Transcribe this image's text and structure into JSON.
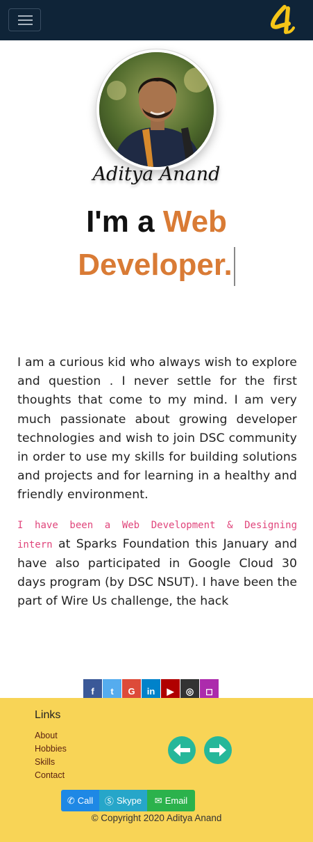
{
  "navbar": {
    "menu_icon": "hamburger-icon",
    "logo_icon": "stylized-4-logo",
    "logo_color": "#f5c518"
  },
  "profile": {
    "name": "Aditya Anand",
    "headline_prefix": "I'm a",
    "headline_accent_1": "Web",
    "headline_accent_2": "Developer.",
    "accent_color": "#d97b35"
  },
  "about": {
    "paragraph_1": "I am a curious kid who always wish to explore and question . I never settle for the first thoughts that come to my mind. I am very much passionate about growing developer technologies and wish to join DSC community in order to use my skills for building solutions and projects and for learning in a healthy and friendly environment.",
    "paragraph_2_code": "I have been a Web Development & Designing intern",
    "paragraph_2_text": " at Sparks Foundation this January and have also participated in Google Cloud 30 days program (by DSC NSUT). I have been the part of Wire Us challenge, the hack"
  },
  "social": [
    {
      "label": "f",
      "icon": "facebook-icon",
      "color": "#3b5998"
    },
    {
      "label": "t",
      "icon": "twitter-icon",
      "color": "#55acee"
    },
    {
      "label": "G",
      "icon": "google-icon",
      "color": "#dd4b39"
    },
    {
      "label": "in",
      "icon": "linkedin-icon",
      "color": "#0082ca"
    },
    {
      "label": "▶",
      "icon": "youtube-icon",
      "color": "#b00000"
    },
    {
      "label": "◎",
      "icon": "github-icon",
      "color": "#333333"
    },
    {
      "label": "◻",
      "icon": "instagram-icon",
      "color": "#ac2bac"
    }
  ],
  "footer": {
    "links_title": "Links",
    "links": [
      "About",
      "Hobbies",
      "Skills",
      "Contact"
    ],
    "contact_buttons": [
      {
        "label": "Call",
        "icon": "phone-icon",
        "color": "#1e88e5"
      },
      {
        "label": "Skype",
        "icon": "skype-icon",
        "color": "#26a6c9"
      },
      {
        "label": "Email",
        "icon": "envelope-icon",
        "color": "#2bb24c"
      }
    ],
    "copyright": "© Copyright 2020 Aditya Anand",
    "background": "#f8d456",
    "arrow_color": "#26b79a"
  }
}
